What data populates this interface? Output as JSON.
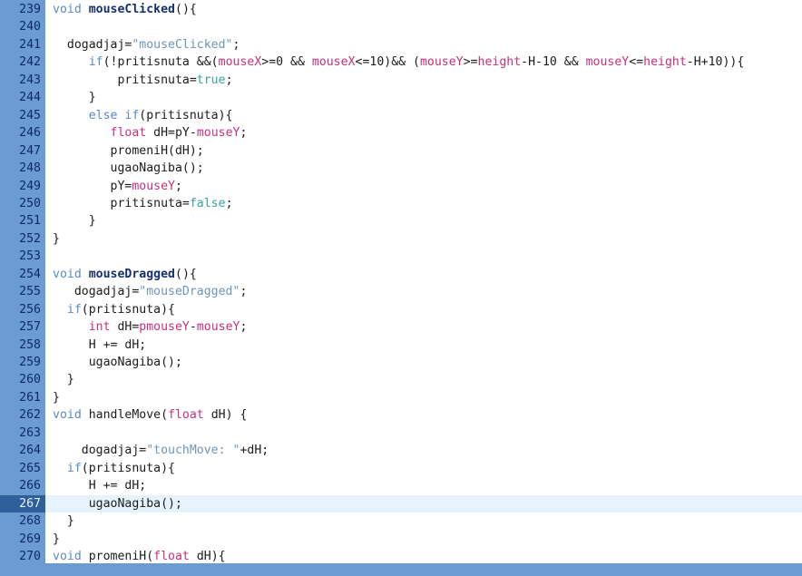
{
  "editor": {
    "current_line": 267,
    "lines": [
      {
        "n": "239",
        "tokens": [
          {
            "t": "void",
            "c": "kw"
          },
          {
            "t": " "
          },
          {
            "t": "mouseClicked",
            "c": "fn"
          },
          {
            "t": "(){"
          }
        ]
      },
      {
        "n": "240",
        "tokens": []
      },
      {
        "n": "241",
        "tokens": [
          {
            "t": "  dogadjaj="
          },
          {
            "t": "\"mouseClicked\"",
            "c": "str"
          },
          {
            "t": ";"
          }
        ]
      },
      {
        "n": "242",
        "tokens": [
          {
            "t": "     "
          },
          {
            "t": "if",
            "c": "kw"
          },
          {
            "t": "(!pritisnuta &&("
          },
          {
            "t": "mouseX",
            "c": "var"
          },
          {
            "t": ">=0 && "
          },
          {
            "t": "mouseX",
            "c": "var"
          },
          {
            "t": "<=10)&& ("
          },
          {
            "t": "mouseY",
            "c": "var"
          },
          {
            "t": ">="
          },
          {
            "t": "height",
            "c": "var"
          },
          {
            "t": "-H-10 && "
          },
          {
            "t": "mouseY",
            "c": "var"
          },
          {
            "t": "<="
          },
          {
            "t": "height",
            "c": "var"
          },
          {
            "t": "-H+10)){"
          }
        ]
      },
      {
        "n": "243",
        "tokens": [
          {
            "t": "         pritisnuta="
          },
          {
            "t": "true",
            "c": "lit"
          },
          {
            "t": ";"
          }
        ]
      },
      {
        "n": "244",
        "tokens": [
          {
            "t": "     }"
          }
        ]
      },
      {
        "n": "245",
        "tokens": [
          {
            "t": "     "
          },
          {
            "t": "else if",
            "c": "kw"
          },
          {
            "t": "(pritisnuta){"
          }
        ]
      },
      {
        "n": "246",
        "tokens": [
          {
            "t": "        "
          },
          {
            "t": "float",
            "c": "var"
          },
          {
            "t": " dH=pY-"
          },
          {
            "t": "mouseY",
            "c": "var"
          },
          {
            "t": ";"
          }
        ]
      },
      {
        "n": "247",
        "tokens": [
          {
            "t": "        promeniH(dH);"
          }
        ]
      },
      {
        "n": "248",
        "tokens": [
          {
            "t": "        ugaoNagiba();"
          }
        ]
      },
      {
        "n": "249",
        "tokens": [
          {
            "t": "        pY="
          },
          {
            "t": "mouseY",
            "c": "var"
          },
          {
            "t": ";"
          }
        ]
      },
      {
        "n": "250",
        "tokens": [
          {
            "t": "        pritisnuta="
          },
          {
            "t": "false",
            "c": "lit"
          },
          {
            "t": ";"
          }
        ]
      },
      {
        "n": "251",
        "tokens": [
          {
            "t": "     }"
          }
        ]
      },
      {
        "n": "252",
        "tokens": [
          {
            "t": "}"
          }
        ]
      },
      {
        "n": "253",
        "tokens": []
      },
      {
        "n": "254",
        "tokens": [
          {
            "t": "void",
            "c": "kw"
          },
          {
            "t": " "
          },
          {
            "t": "mouseDragged",
            "c": "fn"
          },
          {
            "t": "(){"
          }
        ]
      },
      {
        "n": "255",
        "tokens": [
          {
            "t": "   dogadjaj="
          },
          {
            "t": "\"mouseDragged\"",
            "c": "str"
          },
          {
            "t": ";"
          }
        ]
      },
      {
        "n": "256",
        "tokens": [
          {
            "t": "  "
          },
          {
            "t": "if",
            "c": "kw"
          },
          {
            "t": "(pritisnuta){"
          }
        ]
      },
      {
        "n": "257",
        "tokens": [
          {
            "t": "     "
          },
          {
            "t": "int",
            "c": "var"
          },
          {
            "t": " dH="
          },
          {
            "t": "pmouseY",
            "c": "var"
          },
          {
            "t": "-"
          },
          {
            "t": "mouseY",
            "c": "var"
          },
          {
            "t": ";"
          }
        ]
      },
      {
        "n": "258",
        "tokens": [
          {
            "t": "     H += dH;"
          }
        ]
      },
      {
        "n": "259",
        "tokens": [
          {
            "t": "     ugaoNagiba();"
          }
        ]
      },
      {
        "n": "260",
        "tokens": [
          {
            "t": "  }"
          }
        ]
      },
      {
        "n": "261",
        "tokens": [
          {
            "t": "}"
          }
        ]
      },
      {
        "n": "262",
        "tokens": [
          {
            "t": "void",
            "c": "kw"
          },
          {
            "t": " handleMove("
          },
          {
            "t": "float",
            "c": "var"
          },
          {
            "t": " dH) {"
          }
        ]
      },
      {
        "n": "263",
        "tokens": []
      },
      {
        "n": "264",
        "tokens": [
          {
            "t": "    dogadjaj="
          },
          {
            "t": "\"touchMove: \"",
            "c": "str"
          },
          {
            "t": "+dH;"
          }
        ]
      },
      {
        "n": "265",
        "tokens": [
          {
            "t": "  "
          },
          {
            "t": "if",
            "c": "kw"
          },
          {
            "t": "(pritisnuta){"
          }
        ]
      },
      {
        "n": "266",
        "tokens": [
          {
            "t": "     H += dH;"
          }
        ]
      },
      {
        "n": "267",
        "tokens": [
          {
            "t": "     ugaoNagiba();"
          }
        ]
      },
      {
        "n": "268",
        "tokens": [
          {
            "t": "  }"
          }
        ]
      },
      {
        "n": "269",
        "tokens": [
          {
            "t": "}"
          }
        ]
      },
      {
        "n": "270",
        "tokens": [
          {
            "t": "void",
            "c": "kw"
          },
          {
            "t": " promeniH("
          },
          {
            "t": "float",
            "c": "var"
          },
          {
            "t": " dH){"
          }
        ]
      }
    ]
  }
}
